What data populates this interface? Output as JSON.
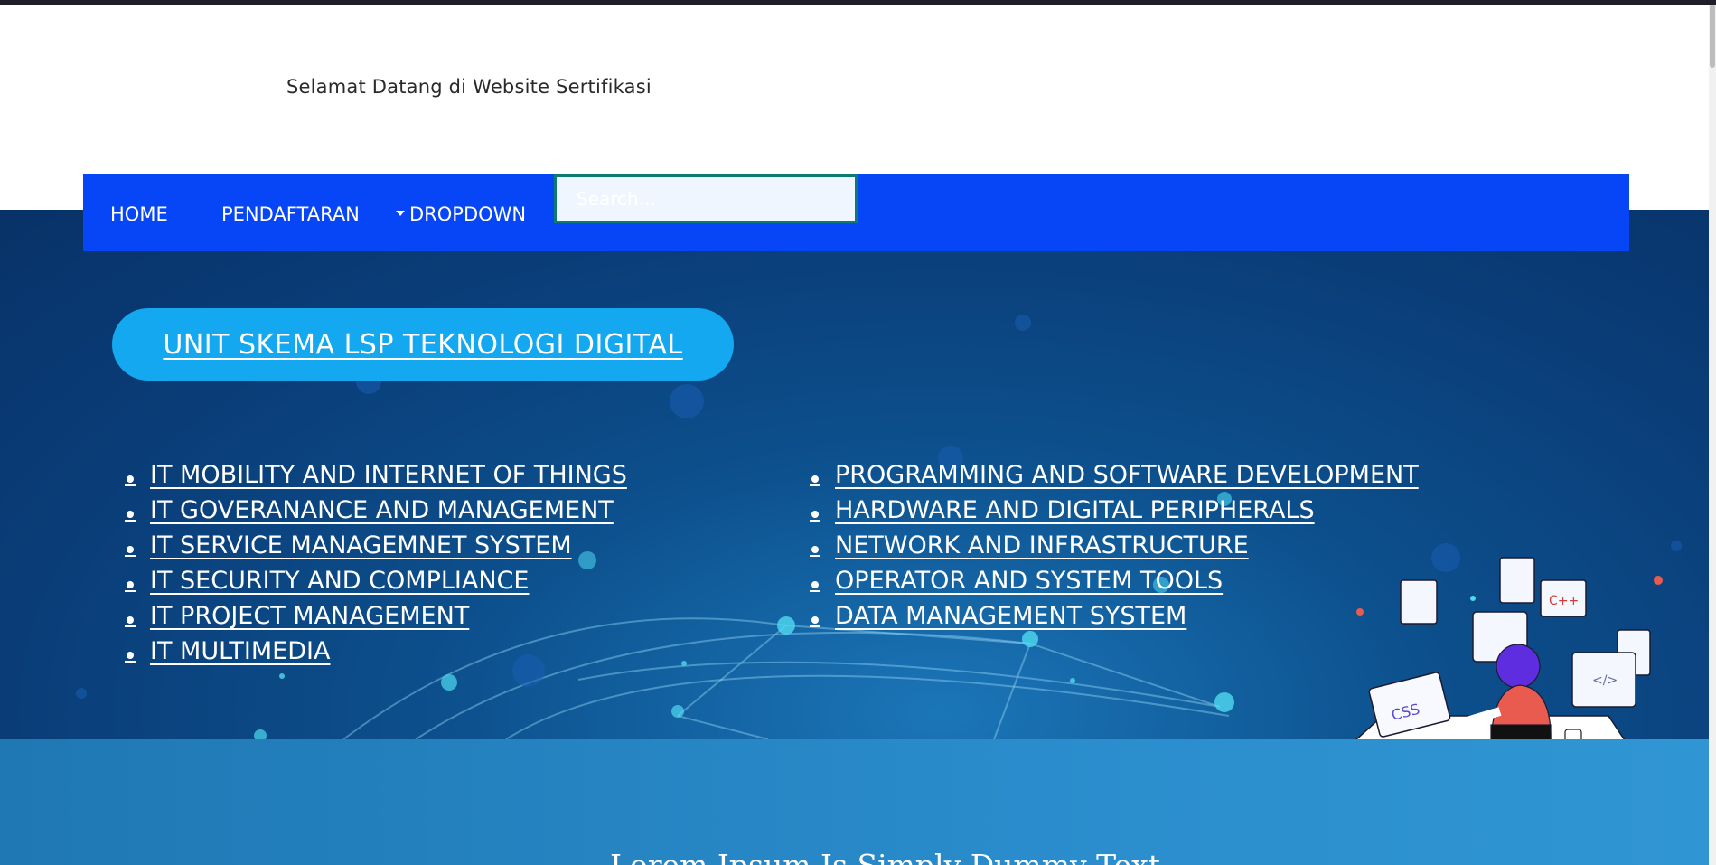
{
  "header": {
    "welcome_text": "Selamat Datang di Website Sertifikasi"
  },
  "navbar": {
    "items": [
      {
        "label": "HOME"
      },
      {
        "label": "PENDAFTARAN"
      },
      {
        "label": "DROPDOWN"
      }
    ],
    "search_placeholder": "Search..."
  },
  "hero": {
    "badge_label": "UNIT SKEMA LSP TEKNOLOGI DIGITAL",
    "left_list": [
      "IT MOBILITY  AND INTERNET OF THINGS",
      "IT GOVERANANCE AND MANAGEMENT",
      "IT SERVICE MANAGEMNET SYSTEM",
      "IT SECURITY AND COMPLIANCE",
      "IT PROJECT MANAGEMENT",
      "IT MULTIMEDIA"
    ],
    "right_list": [
      "PROGRAMMING AND SOFTWARE DEVELOPMENT",
      "HARDWARE AND DIGITAL PERIPHERALS",
      "NETWORK AND INFRASTRUCTURE",
      "OPERATOR AND SYSTEM TOOLS",
      "DATA MANAGEMENT SYSTEM"
    ],
    "illustration": {
      "laptop_text": "CSS",
      "screen_text": "C++",
      "monitor_text": "</>",
      "icon": "programmer-illustration"
    }
  },
  "section2": {
    "title": "Lorem Ipsum Is Simply Dummy Text"
  },
  "colors": {
    "navbar": "#0646f7",
    "hero": "#0a3d78",
    "badge": "#13a8ef",
    "section2": "#2a8ccc"
  }
}
